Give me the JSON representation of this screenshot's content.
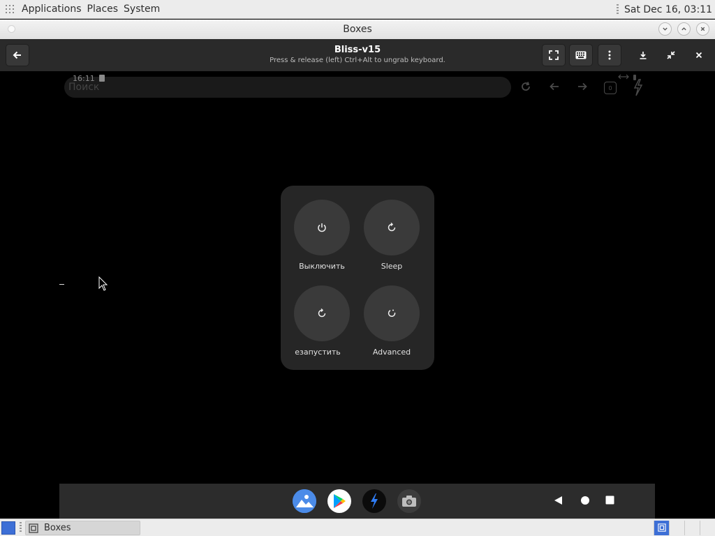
{
  "top_panel": {
    "menus": [
      "Applications",
      "Places",
      "System"
    ],
    "clock": "Sat Dec 16, 03:11"
  },
  "window": {
    "title": "Boxes"
  },
  "headerbar": {
    "title": "Bliss-v15",
    "subtitle": "Press & release (left) Ctrl+Alt to ungrab keyboard."
  },
  "vm": {
    "status_time": "16:11",
    "search_placeholder": "Поиск",
    "tab_count": "0",
    "power_menu": {
      "items": [
        {
          "label": "Выключить",
          "icon": "power-icon"
        },
        {
          "label": "Sleep",
          "icon": "refresh-icon"
        },
        {
          "label": "езапустить",
          "icon": "restart-icon"
        },
        {
          "label": "Advanced",
          "icon": "advanced-icon"
        }
      ]
    },
    "dock_apps": [
      "gallery-icon",
      "play-store-icon",
      "lightning-app-icon",
      "camera-icon"
    ],
    "nav_buttons": [
      "back-triangle-icon",
      "home-circle-icon",
      "recents-square-icon"
    ]
  },
  "taskbar": {
    "item_label": "Boxes",
    "workspace_count": 4
  },
  "colors": {
    "panel_bg": "#ececec",
    "headerbar_bg": "#2a2a2a",
    "power_panel_bg": "#262626",
    "power_button_bg": "#3a3a3a",
    "dock_bg": "#2c2c2c",
    "accent": "#3d6fd6"
  }
}
